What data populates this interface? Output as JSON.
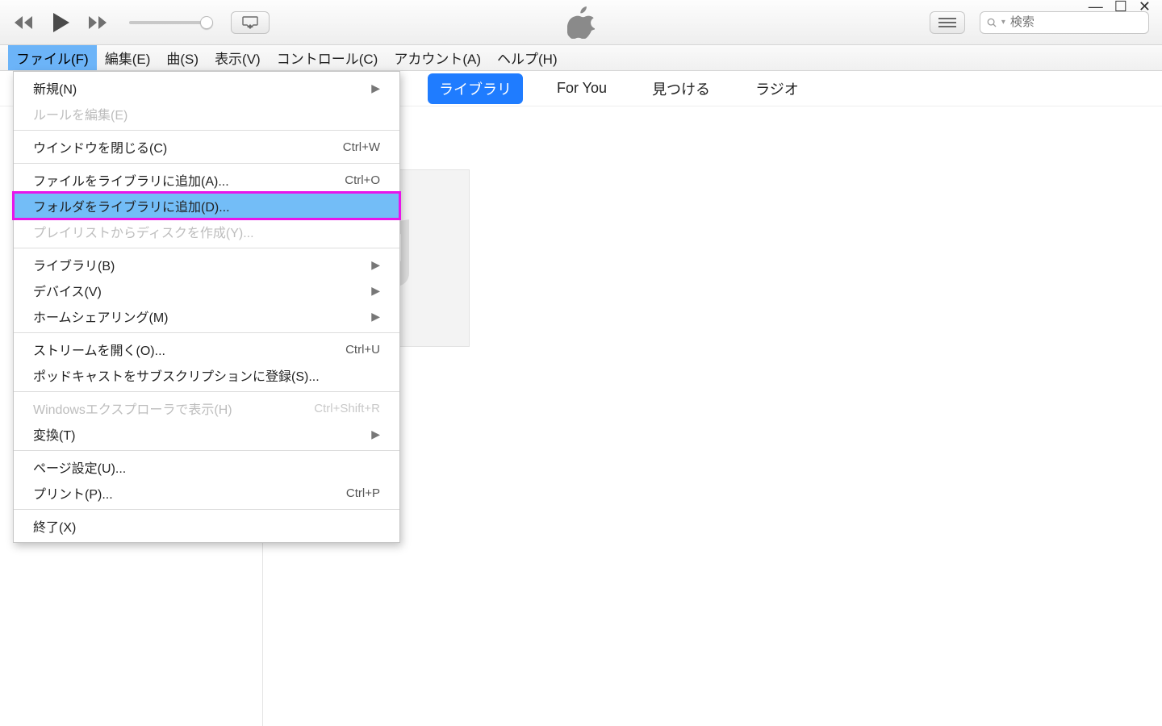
{
  "search": {
    "placeholder": "検索"
  },
  "menubar": {
    "items": [
      {
        "label": "ファイル(F)",
        "active": true
      },
      {
        "label": "編集(E)"
      },
      {
        "label": "曲(S)"
      },
      {
        "label": "表示(V)"
      },
      {
        "label": "コントロール(C)"
      },
      {
        "label": "アカウント(A)"
      },
      {
        "label": "ヘルプ(H)"
      }
    ]
  },
  "tabs": {
    "items": [
      {
        "label": "ライブラリ",
        "active": true
      },
      {
        "label": "For You"
      },
      {
        "label": "見つける"
      },
      {
        "label": "ラジオ"
      }
    ]
  },
  "dropdown": {
    "items": [
      {
        "label": "新規(N)",
        "submenu": true
      },
      {
        "label": "ルールを編集(E)",
        "disabled": true
      },
      {
        "sep": true
      },
      {
        "label": "ウインドウを閉じる(C)",
        "shortcut": "Ctrl+W"
      },
      {
        "sep": true
      },
      {
        "label": "ファイルをライブラリに追加(A)...",
        "shortcut": "Ctrl+O"
      },
      {
        "label": "フォルダをライブラリに追加(D)...",
        "highlight": true
      },
      {
        "label": "プレイリストからディスクを作成(Y)...",
        "disabled": true
      },
      {
        "sep": true
      },
      {
        "label": "ライブラリ(B)",
        "submenu": true
      },
      {
        "label": "デバイス(V)",
        "submenu": true
      },
      {
        "label": "ホームシェアリング(M)",
        "submenu": true
      },
      {
        "sep": true
      },
      {
        "label": "ストリームを開く(O)...",
        "shortcut": "Ctrl+U"
      },
      {
        "label": "ポッドキャストをサブスクリプションに登録(S)..."
      },
      {
        "sep": true
      },
      {
        "label": "Windowsエクスプローラで表示(H)",
        "shortcut": "Ctrl+Shift+R",
        "disabled": true
      },
      {
        "label": "変換(T)",
        "submenu": true
      },
      {
        "sep": true
      },
      {
        "label": "ページ設定(U)..."
      },
      {
        "label": "プリント(P)...",
        "shortcut": "Ctrl+P"
      },
      {
        "sep": true
      },
      {
        "label": "終了(X)"
      }
    ]
  }
}
